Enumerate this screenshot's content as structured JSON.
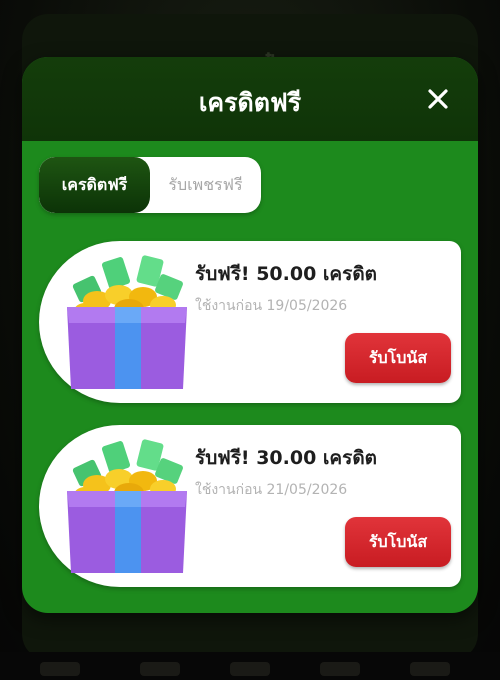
{
  "background": {
    "title": "กระเป๋า"
  },
  "modal": {
    "title": "เครดิตฟรี",
    "tabs": [
      {
        "label": "เครดิตฟรี",
        "active": true
      },
      {
        "label": "รับเพชรฟรี",
        "active": false
      }
    ],
    "cards": [
      {
        "title": "รับฟรี! 50.00 เครดิต",
        "expiry": "ใช้งานก่อน 19/05/2026",
        "button": "รับโบนัส",
        "icon": "gift-box-icon"
      },
      {
        "title": "รับฟรี! 30.00 เครดิต",
        "expiry": "ใช้งานก่อน 21/05/2026",
        "button": "รับโบนัส",
        "icon": "gift-box-icon"
      }
    ]
  },
  "colors": {
    "header": "#143d0b",
    "body": "#1d8a1d",
    "button": "#d82a30",
    "active_tab": "#1e5512"
  }
}
